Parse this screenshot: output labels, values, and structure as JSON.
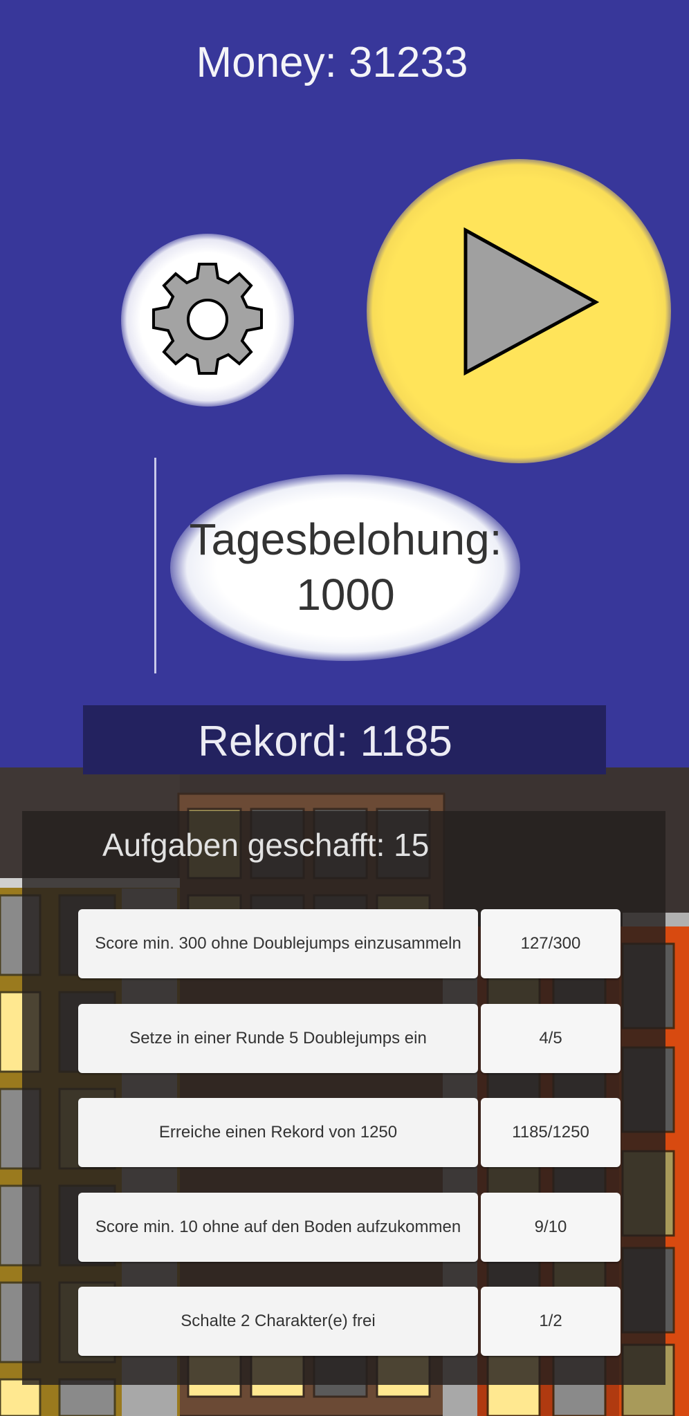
{
  "hud": {
    "money": "Money: 31233"
  },
  "buttons": {
    "settings": "gear-icon",
    "play": "play-icon"
  },
  "daily_reward": {
    "line1": "Tagesbelohung:",
    "line2": "1000"
  },
  "record": {
    "label": "Rekord: 1185"
  },
  "quests": {
    "title": "Aufgaben geschafft: 15",
    "items": [
      {
        "desc": "Score min. 300 ohne Doublejumps einzusammeln",
        "progress": "127/300"
      },
      {
        "desc": "Setze in einer Runde 5 Doublejumps ein",
        "progress": "4/5"
      },
      {
        "desc": "Erreiche einen Rekord von 1250",
        "progress": "1185/1250"
      },
      {
        "desc": "Score min. 10 ohne auf den Boden aufzukommen",
        "progress": "9/10"
      },
      {
        "desc": "Schalte 2 Charakter(e) frei",
        "progress": "1/2"
      }
    ]
  },
  "colors": {
    "sky": "#38379a",
    "play_button": "#ffe45a",
    "settings_button": "#ffffff",
    "record_bar": "#23225f"
  }
}
